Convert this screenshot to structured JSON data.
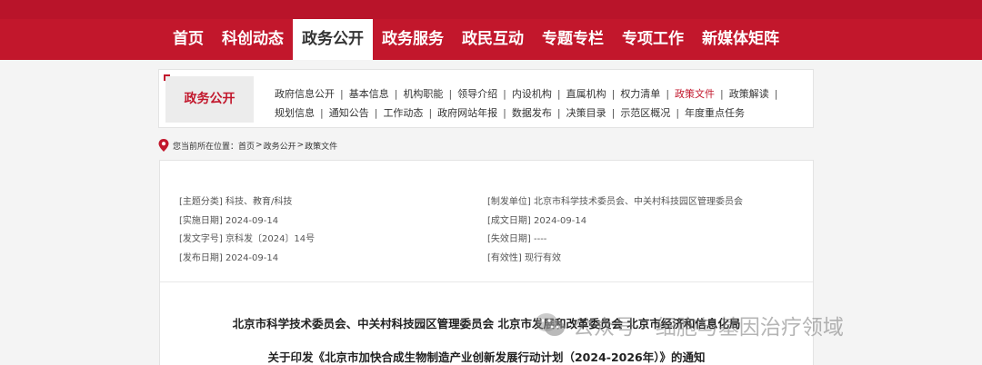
{
  "nav": {
    "items": [
      "首页",
      "科创动态",
      "政务公开",
      "政务服务",
      "政民互动",
      "专题专栏",
      "专项工作",
      "新媒体矩阵"
    ],
    "active_index": 2
  },
  "panel": {
    "title": "政务公开",
    "links_row1": [
      "政府信息公开",
      "基本信息",
      "机构职能",
      "领导介绍",
      "内设机构",
      "直属机构",
      "权力清单",
      "政策文件",
      "政策解读"
    ],
    "links_row2": [
      "规划信息",
      "通知公告",
      "工作动态",
      "政府网站年报",
      "数据发布",
      "决策目录",
      "示范区概况",
      "年度重点任务"
    ],
    "active_link": "政策文件",
    "separator": "|"
  },
  "breadcrumb": {
    "prefix": "您当前所在位置：",
    "items": [
      "首页",
      "政务公开",
      "政策文件"
    ],
    "separator": ">"
  },
  "meta": {
    "subject": "[主题分类] 科技、教育/科技",
    "issuer": "[制发单位] 北京市科学技术委员会、中关村科技园区管理委员会",
    "effective_date": "[实施日期] 2024-09-14",
    "created_date": "[成文日期] 2024-09-14",
    "doc_number": "[发文字号] 京科发〔2024〕14号",
    "expiry_date": "[失效日期] ----",
    "publish_date": "[发布日期] 2024-09-14",
    "validity": "[有效性] 现行有效"
  },
  "document": {
    "title_line1": "北京市科学技术委员会、中关村科技园区管理委员会 北京市发展和改革委员会 北京市经济和信息化局",
    "title_line2": "关于印发《北京市加快合成生物制造产业创新发展行动计划（2024-2026年）》的通知"
  },
  "watermark": {
    "text": "公众号 · 细胞与基因治疗领域"
  },
  "colors": {
    "brand_red": "#c2172c",
    "text_dark": "#333333",
    "text_meta": "#555555"
  },
  "icons": {
    "breadcrumb": "location-pin-icon",
    "watermark": "wechat-icon"
  }
}
